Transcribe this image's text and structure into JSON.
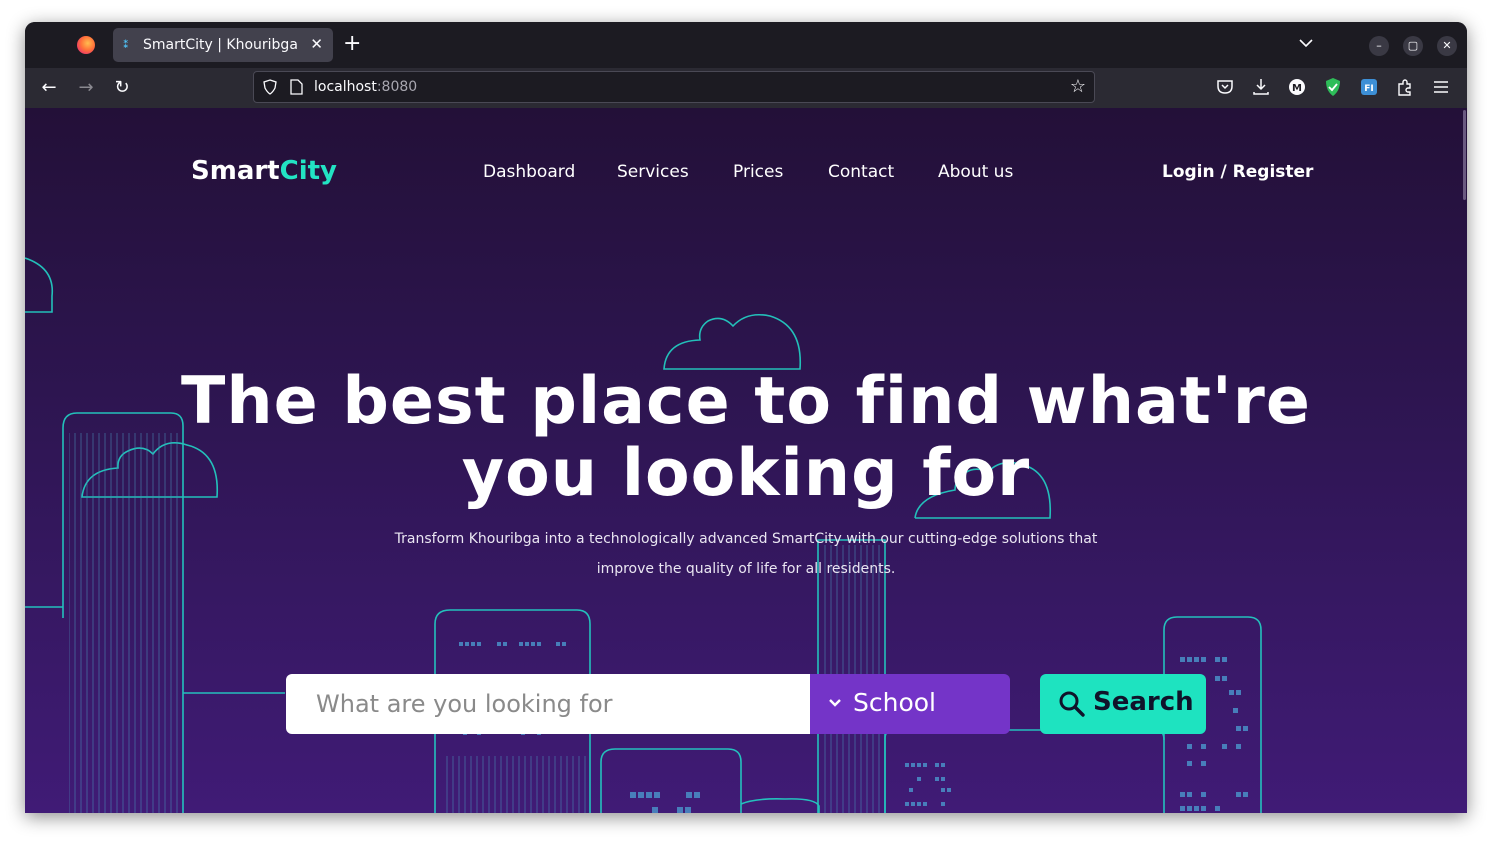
{
  "browser": {
    "tab_title": "SmartCity | Khouribga",
    "url_host": "localhost",
    "url_port": ":8080"
  },
  "site": {
    "logo_part1": "Smart",
    "logo_part2": "City",
    "nav": [
      "Dashboard",
      "Services",
      "Prices",
      "Contact",
      "About us"
    ],
    "login_label": "Login / Register"
  },
  "hero": {
    "title_line1": "The best place to find what're",
    "title_line2": "you looking for",
    "subtitle_line1": "Transform Khouribga into a technologically advanced SmartCity with our cutting-edge solutions that",
    "subtitle_line2": "improve the quality of life for all residents."
  },
  "search": {
    "placeholder": "What are you looking for",
    "category": "School",
    "button_label": "Search"
  },
  "colors": {
    "accent": "#22e3c3",
    "select_bg": "#7434c8",
    "page_bg_top": "#231038",
    "page_bg_bottom": "#401b76"
  }
}
